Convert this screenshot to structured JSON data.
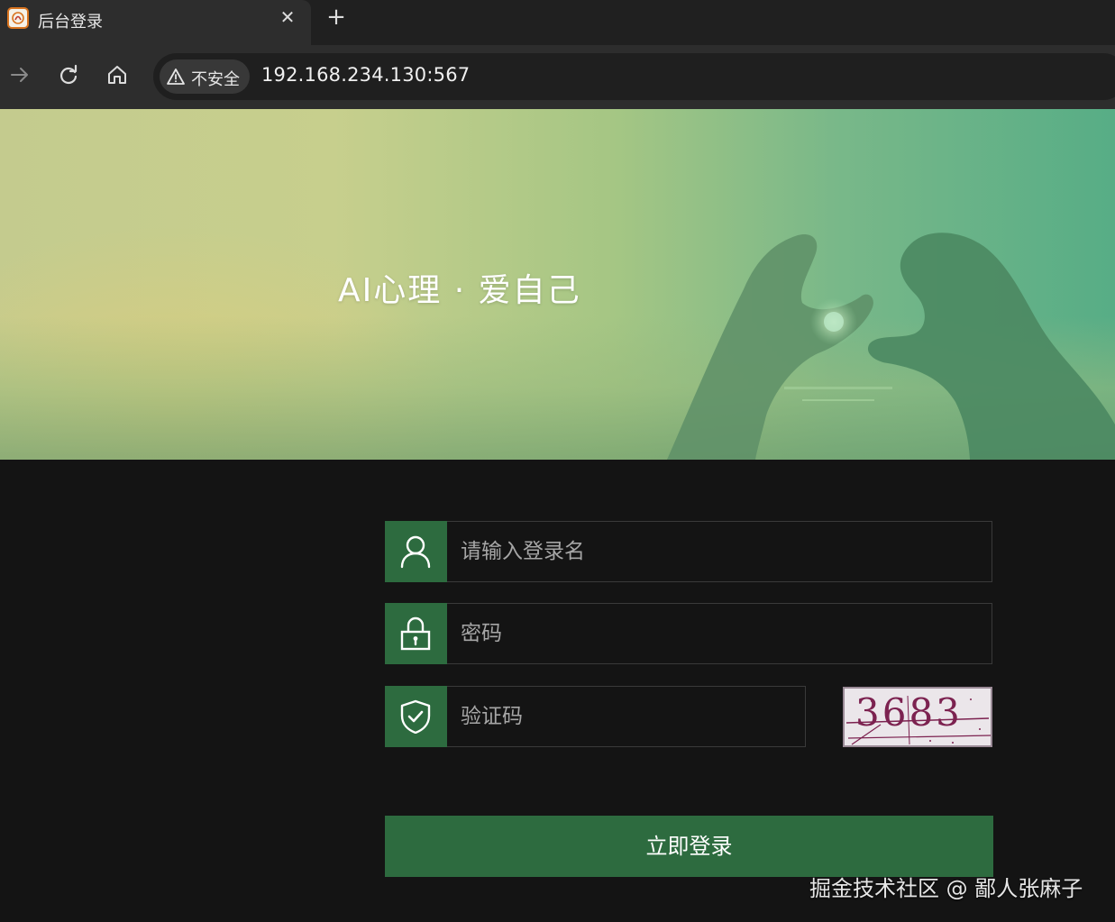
{
  "browser": {
    "tab_title": "后台登录",
    "close_glyph": "✕",
    "new_tab_glyph": "+",
    "security_label": "不安全",
    "url": "192.168.234.130:567"
  },
  "hero": {
    "title": "AI心理 · 爱自己"
  },
  "login": {
    "username_placeholder": "请输入登录名",
    "password_placeholder": "密码",
    "captcha_placeholder": "验证码",
    "captcha_code": "3683",
    "submit_label": "立即登录"
  },
  "watermark": "掘金技术社区 @ 鄙人张麻子",
  "colors": {
    "accent_green": "#2d6b3f",
    "page_background": "#141414"
  },
  "icons": {
    "forward": "arrow-right-icon",
    "reload": "reload-icon",
    "home": "home-icon",
    "security": "warning-triangle-icon",
    "username": "user-icon",
    "password": "lock-icon",
    "captcha": "shield-check-icon"
  }
}
